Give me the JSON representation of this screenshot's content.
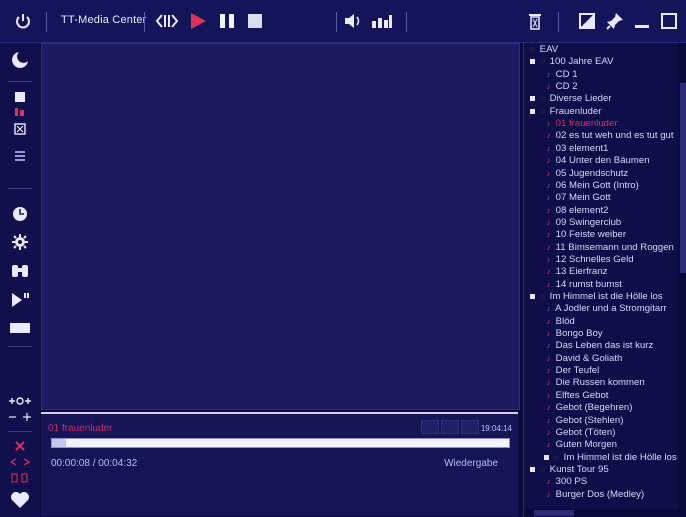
{
  "app": {
    "title": "TT-Media Center"
  },
  "colors": {
    "accent": "#e0305a",
    "background": "#0b0b3a",
    "text": "#cfd3ff"
  },
  "toolbar": {
    "power_icon": "power-icon",
    "prev_next_icon": "skip-icon",
    "play_icon": "play-icon",
    "pause_icon": "pause-icon",
    "stop_icon": "stop-icon",
    "volume_icon": "volume-icon",
    "equalizer_icon": "equalizer-icon",
    "trash_icon": "trash-icon",
    "restore_icon": "restore-icon",
    "pin_icon": "pin-icon",
    "minimize_icon": "minimize-icon",
    "maximize_icon": "maximize-icon"
  },
  "player": {
    "track_title": "01 frauenluder",
    "elapsed_small": "19:04:14",
    "time_readout": "00:00:08 / 00:04:32",
    "status": "Wiedergabe",
    "progress": 0.03
  },
  "playlist": [
    {
      "text": "EAV",
      "indent": 0,
      "kind": "root"
    },
    {
      "text": "100 Jahre EAV",
      "indent": 1,
      "kind": "folder"
    },
    {
      "text": "CD 1",
      "indent": 2,
      "kind": "item"
    },
    {
      "text": "CD 2",
      "indent": 2,
      "kind": "item"
    },
    {
      "text": "Diverse Lieder",
      "indent": 1,
      "kind": "folder"
    },
    {
      "text": "Frauenluder",
      "indent": 1,
      "kind": "folder"
    },
    {
      "text": "01 frauenluder",
      "indent": 2,
      "kind": "item",
      "active": true
    },
    {
      "text": "02 es tut weh und es tut gut",
      "indent": 2,
      "kind": "item"
    },
    {
      "text": "03 element1",
      "indent": 2,
      "kind": "item"
    },
    {
      "text": "04 Unter den Bäumen",
      "indent": 2,
      "kind": "item"
    },
    {
      "text": "05 Jugendschutz",
      "indent": 2,
      "kind": "item"
    },
    {
      "text": "06 Mein Gott (Intro)",
      "indent": 2,
      "kind": "item"
    },
    {
      "text": "07 Mein Gott",
      "indent": 2,
      "kind": "item"
    },
    {
      "text": "08 element2",
      "indent": 2,
      "kind": "item"
    },
    {
      "text": "09 Swingerclub",
      "indent": 2,
      "kind": "item"
    },
    {
      "text": "10 Feiste weiber",
      "indent": 2,
      "kind": "item"
    },
    {
      "text": "11 Bimsemann und Roggen",
      "indent": 2,
      "kind": "item"
    },
    {
      "text": "12 Schnelles Geld",
      "indent": 2,
      "kind": "item"
    },
    {
      "text": "13 Eierfranz",
      "indent": 2,
      "kind": "item"
    },
    {
      "text": "14 rumst bumst",
      "indent": 2,
      "kind": "item"
    },
    {
      "text": "Im Himmel ist die Hölle los",
      "indent": 1,
      "kind": "folder"
    },
    {
      "text": "A Jodler und a Stromgitarr",
      "indent": 2,
      "kind": "item"
    },
    {
      "text": "Blöd",
      "indent": 2,
      "kind": "item"
    },
    {
      "text": "Bongo Boy",
      "indent": 2,
      "kind": "item"
    },
    {
      "text": "Das Leben das ist kurz",
      "indent": 2,
      "kind": "item"
    },
    {
      "text": "David & Goliath",
      "indent": 2,
      "kind": "item"
    },
    {
      "text": "Der Teufel",
      "indent": 2,
      "kind": "item"
    },
    {
      "text": "Die Russen kommen",
      "indent": 2,
      "kind": "item"
    },
    {
      "text": "Elftes Gebot",
      "indent": 2,
      "kind": "item"
    },
    {
      "text": "Gebot (Begehren)",
      "indent": 2,
      "kind": "item"
    },
    {
      "text": "Gebot (Stehlen)",
      "indent": 2,
      "kind": "item"
    },
    {
      "text": "Gebot (Töten)",
      "indent": 2,
      "kind": "item"
    },
    {
      "text": "Guten Morgen",
      "indent": 2,
      "kind": "item"
    },
    {
      "text": "Im Himmel ist die Hölle los",
      "indent": 2,
      "kind": "folder"
    },
    {
      "text": "Kunst Tour 95",
      "indent": 1,
      "kind": "folder"
    },
    {
      "text": "300 PS",
      "indent": 2,
      "kind": "item"
    },
    {
      "text": "Burger Dos (Medley)",
      "indent": 2,
      "kind": "item"
    }
  ]
}
